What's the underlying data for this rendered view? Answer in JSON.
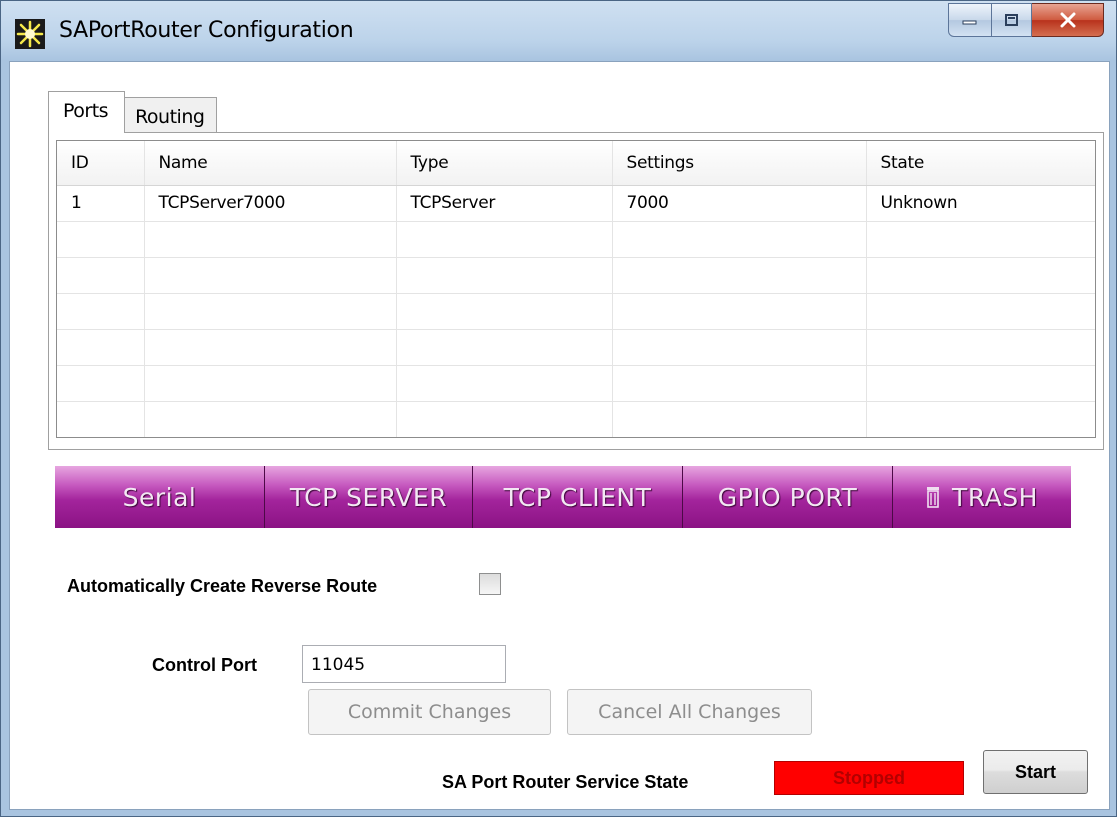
{
  "window": {
    "title": "SAPortRouter Configuration"
  },
  "tabs": [
    {
      "label": "Ports",
      "active": true
    },
    {
      "label": "Routing",
      "active": false
    }
  ],
  "ports_table": {
    "columns": [
      "ID",
      "Name",
      "Type",
      "Settings",
      "State"
    ],
    "rows": [
      [
        "1",
        "TCPServer7000",
        "TCPServer",
        "7000",
        "Unknown"
      ]
    ]
  },
  "port_buttons": {
    "serial": "Serial",
    "tcp_server": "TCP SERVER",
    "tcp_client": "TCP CLIENT",
    "gpio_port": "GPIO PORT",
    "trash": "TRASH"
  },
  "options": {
    "auto_reverse_label": "Automatically Create Reverse Route",
    "auto_reverse_checked": false,
    "control_port_label": "Control Port",
    "control_port_value": "11045"
  },
  "actions": {
    "commit": "Commit Changes",
    "cancel_all": "Cancel All Changes"
  },
  "service": {
    "label": "SA Port Router Service State",
    "state": "Stopped",
    "start_button": "Start"
  },
  "colors": {
    "status_stopped": "#ff0000",
    "button_bar": "#a3249c"
  }
}
